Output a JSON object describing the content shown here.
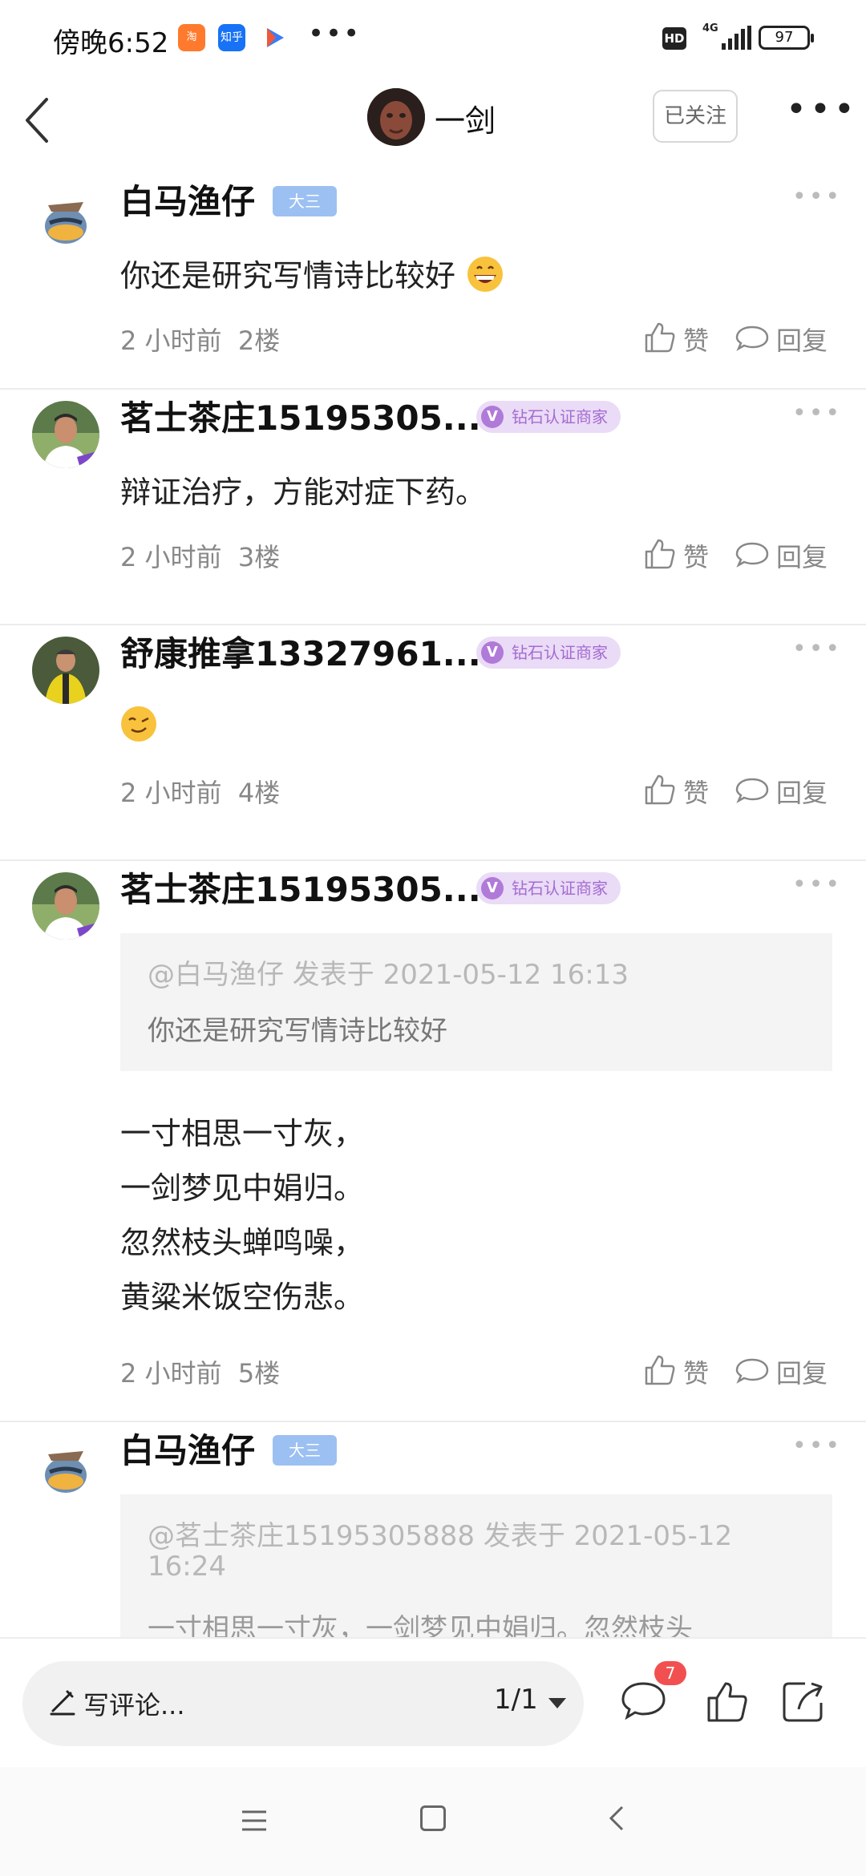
{
  "status_bar": {
    "time": "傍晚6:52",
    "apps": [
      "taobao-icon",
      "zhihu-icon",
      "video-icon"
    ],
    "zhihu_label": "知乎",
    "more": "•••",
    "hd": "HD",
    "network": "4G",
    "battery": "97"
  },
  "header": {
    "name": "一剑",
    "follow_label": "已关注",
    "more": "•••"
  },
  "posts": [
    {
      "author": "白马渔仔",
      "badge": "大三",
      "text": "你还是研究写情诗比较好",
      "emoji": "grinning-face",
      "time": "2 小时前",
      "floor": "2楼"
    },
    {
      "author": "茗士茶庄15195305...",
      "badge": "钻石认证商家",
      "badge_v": "V",
      "text": "辩证治疗，方能对症下药。",
      "time": "2 小时前",
      "floor": "3楼"
    },
    {
      "author": "舒康推拿13327961...",
      "badge": "钻石认证商家",
      "badge_v": "V",
      "emoji": "smirking-face",
      "time": "2 小时前",
      "floor": "4楼"
    },
    {
      "author": "茗士茶庄15195305...",
      "badge": "钻石认证商家",
      "badge_v": "V",
      "quote_head": "@白马渔仔 发表于 2021-05-12 16:13",
      "quote_body": "你还是研究写情诗比较好",
      "lines": [
        "一寸相思一寸灰，",
        "一剑梦见中娟归。",
        "忽然枝头蝉鸣噪，",
        "黄粱米饭空伤悲。"
      ],
      "time": "2 小时前",
      "floor": "5楼"
    },
    {
      "author": "白马渔仔",
      "badge": "大三",
      "quote_head": "@茗士茶庄15195305888 发表于 2021-05-12",
      "quote_head2": "16:24",
      "quote_body": "一寸相思一寸灰，一剑梦见中娟归。忽然枝头"
    }
  ],
  "actions": {
    "like": "赞",
    "reply": "回复",
    "more": "•••"
  },
  "bottom_bar": {
    "placeholder": "写评论...",
    "page": "1/1",
    "comment_count": "7"
  },
  "colors": {
    "rank_badge": "#9cc0f2",
    "merchant_badge_bg": "#eadbf6",
    "merchant_badge_text": "#a46bd1",
    "count_badge": "#f25050"
  }
}
